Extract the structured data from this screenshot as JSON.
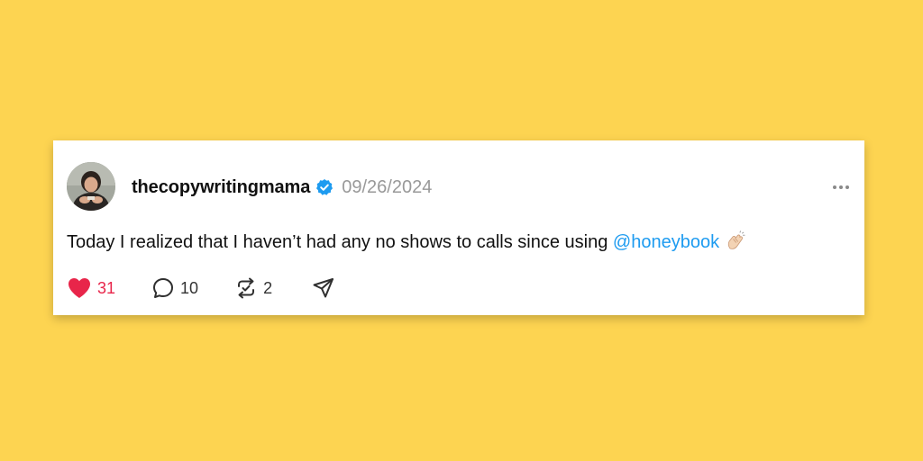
{
  "post": {
    "username": "thecopywritingmama",
    "date": "09/26/2024",
    "text": "Today I realized that I haven’t had any no shows to calls since using ",
    "mention": "@honeybook",
    "emoji": "clapping-hands-emoji",
    "likes": "31",
    "replies": "10",
    "reposts": "2",
    "liked": true
  },
  "colors": {
    "background": "#FDD451",
    "card": "#FFFFFF",
    "mention": "#1D9BF0",
    "like": "#E8254A",
    "verified": "#1D9BF0",
    "date": "#999999"
  },
  "icons": {
    "verified": "verified-badge-icon",
    "more": "more-dots-icon",
    "like": "heart-icon",
    "reply": "comment-bubble-icon",
    "repost": "repost-icon",
    "share": "send-icon"
  }
}
